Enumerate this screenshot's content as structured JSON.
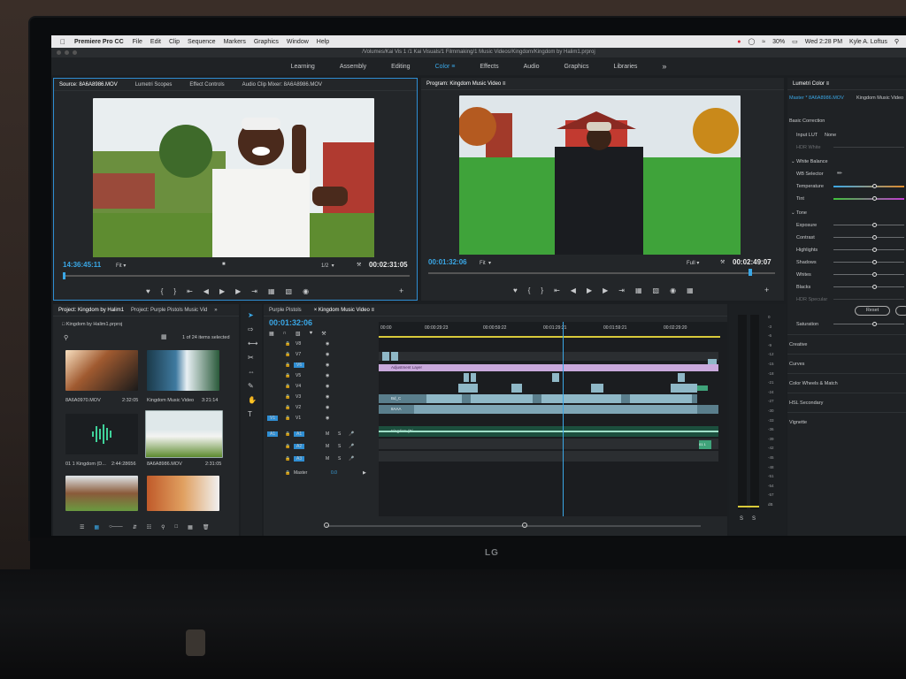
{
  "menubar": {
    "app_name": "Premiere Pro CC",
    "items": [
      "File",
      "Edit",
      "Clip",
      "Sequence",
      "Markers",
      "Graphics",
      "Window",
      "Help"
    ],
    "battery": "30%",
    "clock": "Wed 2:28 PM",
    "user": "Kyle A. Loftus"
  },
  "title_path": "/Volumes/Kai Vis 1 /1 Kai Visuals/1 Filmmaking/1 Music Videos/Kingdom/Kingdom by Halim1.prproj",
  "workspaces": {
    "items": [
      "Learning",
      "Assembly",
      "Editing",
      "Color",
      "Effects",
      "Audio",
      "Graphics",
      "Libraries"
    ],
    "active": "Color",
    "more": "»"
  },
  "source_monitor": {
    "tabs": [
      "Source: 8A6A8986.MOV",
      "Lumetri Scopes",
      "Effect Controls",
      "Audio Clip Mixer: 8A6A8986.MOV"
    ],
    "timecode_in": "14:36:45:11",
    "fit": "Fit",
    "scale": "1/2",
    "timecode_out": "00:02:31:05"
  },
  "program_monitor": {
    "tab": "Program: Kingdom Music Video",
    "timecode_in": "00:01:32:06",
    "fit": "Fit",
    "quality": "Full",
    "timecode_out": "00:02:49:07"
  },
  "lumetri": {
    "title": "Lumetri Color",
    "master": "Master * 8A6A8986.MOV",
    "target": "Kingdom Music Video",
    "basic_correction": "Basic Correction",
    "input_lut_label": "Input LUT",
    "input_lut_value": "None",
    "hdr_white": "HDR White",
    "white_balance": "White Balance",
    "wb_selector": "WB Selector",
    "temperature": "Temperature",
    "tint": "Tint",
    "tone": "Tone",
    "tone_sliders": [
      "Exposure",
      "Contrast",
      "Highlights",
      "Shadows",
      "Whites",
      "Blacks"
    ],
    "hdr_specular": "HDR Specular",
    "reset": "Reset",
    "saturation": "Saturation",
    "sections": [
      "Creative",
      "Curves",
      "Color Wheels & Match",
      "HSL Secondary",
      "Vignette"
    ]
  },
  "project": {
    "tabs": [
      "Project: Kingdom by Halim1",
      "Project: Purple Pistols Music Vid"
    ],
    "more": "»",
    "file": "Kingdom by Halim1.prproj",
    "count": "1 of 24 items selected",
    "items": [
      {
        "name": "8A6A0970.MOV",
        "duration": "2:32:05"
      },
      {
        "name": "Kingdom Music Video",
        "duration": "3:21:14"
      },
      {
        "name": "01 1 Kingdom (D...",
        "duration": "2:44:28656"
      },
      {
        "name": "8A6A8986.MOV",
        "duration": "2:31:05"
      }
    ]
  },
  "timeline": {
    "tabs": [
      "Purple Pistols",
      "Kingdom Music Video"
    ],
    "timecode": "00:01:32:06",
    "ruler": [
      "00:00",
      "00:00:29:23",
      "00:00:59:22",
      "00:01:29:21",
      "00:01:59:21",
      "00:02:29:20"
    ],
    "video_tracks": [
      "V8",
      "V7",
      "V6",
      "V5",
      "V4",
      "V3",
      "V2",
      "V1"
    ],
    "audio_tracks": [
      "A1",
      "A2",
      "A3"
    ],
    "src_v": "V1",
    "src_a": "A1",
    "master": "Master",
    "master_val": "0.0",
    "adjustment_layer": "Adjustment Layer",
    "clip_label_1": "Bd_C",
    "clip_label_2": "8AAA",
    "audio_label": "Kingdom (Di...",
    "audio_end": "01 1"
  },
  "meters": {
    "scale": [
      "0",
      "-3",
      "-6",
      "-9",
      "-12",
      "-15",
      "-18",
      "-21",
      "-24",
      "-27",
      "-30",
      "-33",
      "-36",
      "-39",
      "-42",
      "-45",
      "-48",
      "-51",
      "-54",
      "-57",
      "dB"
    ],
    "solo": [
      "S",
      "S"
    ]
  },
  "monitor_brand": "LG"
}
